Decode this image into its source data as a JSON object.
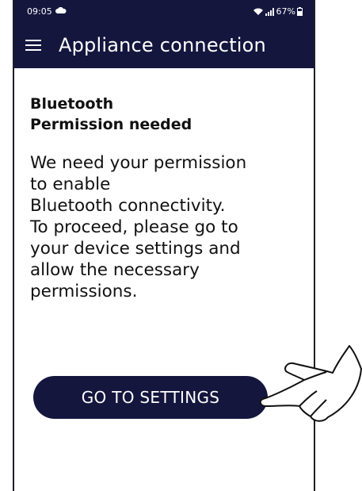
{
  "status_bar": {
    "time": "09:05",
    "battery_text": "67%",
    "icons": [
      "cloud-icon",
      "wifi-icon",
      "signal-icon",
      "battery-icon"
    ]
  },
  "app_bar": {
    "title": "Appliance connection",
    "menu_icon": "hamburger-menu-icon"
  },
  "content": {
    "heading_line1": "Bluetooth",
    "heading_line2": "Permission needed",
    "body_lines": [
      "We need your permission",
      "to enable",
      "Bluetooth connectivity.",
      "To proceed, please go to",
      "your device settings and",
      "allow the necessary",
      "permissions."
    ]
  },
  "button": {
    "label": "GO TO SETTINGS"
  },
  "colors": {
    "navy": "#14163e",
    "text": "#111111",
    "background": "#ffffff"
  }
}
